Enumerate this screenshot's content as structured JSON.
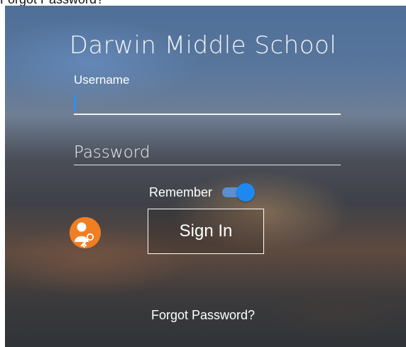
{
  "clipped_text": "Forgot Password?",
  "school_name": "Darwin Middle School",
  "username": {
    "label": "Username",
    "value": ""
  },
  "password": {
    "placeholder": "Password",
    "value": ""
  },
  "remember": {
    "label": "Remember",
    "checked": true
  },
  "sign_in_label": "Sign In",
  "forgot_password_label": "Forgot Password?",
  "colors": {
    "accent": "#1e88f0",
    "badge": "#f07e23"
  },
  "icons": {
    "badge": "user-key-icon"
  }
}
